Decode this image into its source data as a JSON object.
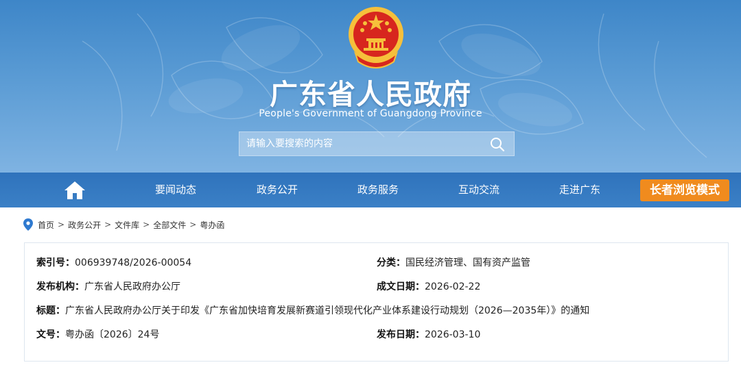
{
  "header": {
    "title": "广东省人民政府",
    "subtitle": "People's Government of Guangdong Province",
    "emblem_icon": "national-emblem-icon"
  },
  "search": {
    "placeholder": "请输入要搜索的内容",
    "value": ""
  },
  "nav": {
    "home_icon": "home-icon",
    "items": [
      {
        "label": "要闻动态"
      },
      {
        "label": "政务公开"
      },
      {
        "label": "政务服务"
      },
      {
        "label": "互动交流"
      },
      {
        "label": "走进广东"
      }
    ],
    "elder_mode": "长者浏览模式"
  },
  "breadcrumb": {
    "items": [
      "首页",
      "政务公开",
      "文件库",
      "全部文件",
      "粤办函"
    ],
    "separator": ">"
  },
  "document": {
    "index_no": {
      "label": "索引号：",
      "value": "006939748/2026-00054"
    },
    "category": {
      "label": "分类：",
      "value": "国民经济管理、国有资产监管"
    },
    "publisher": {
      "label": "发布机构：",
      "value": "广东省人民政府办公厅"
    },
    "created_date": {
      "label": "成文日期：",
      "value": "2026-02-22"
    },
    "title": {
      "label": "标题：",
      "value": "广东省人民政府办公厅关于印发《广东省加快培育发展新赛道引领现代化产业体系建设行动规划（2026—2035年）》的通知"
    },
    "doc_no": {
      "label": "文号：",
      "value": "粤办函〔2026〕24号"
    },
    "publish_date": {
      "label": "发布日期：",
      "value": "2026-03-10"
    }
  },
  "colors": {
    "banner": "#4a8fcf",
    "nav": "#3378c1",
    "elder_button": "#f08b1e",
    "emblem_red": "#d7261e",
    "emblem_gold": "#f6c03b"
  }
}
